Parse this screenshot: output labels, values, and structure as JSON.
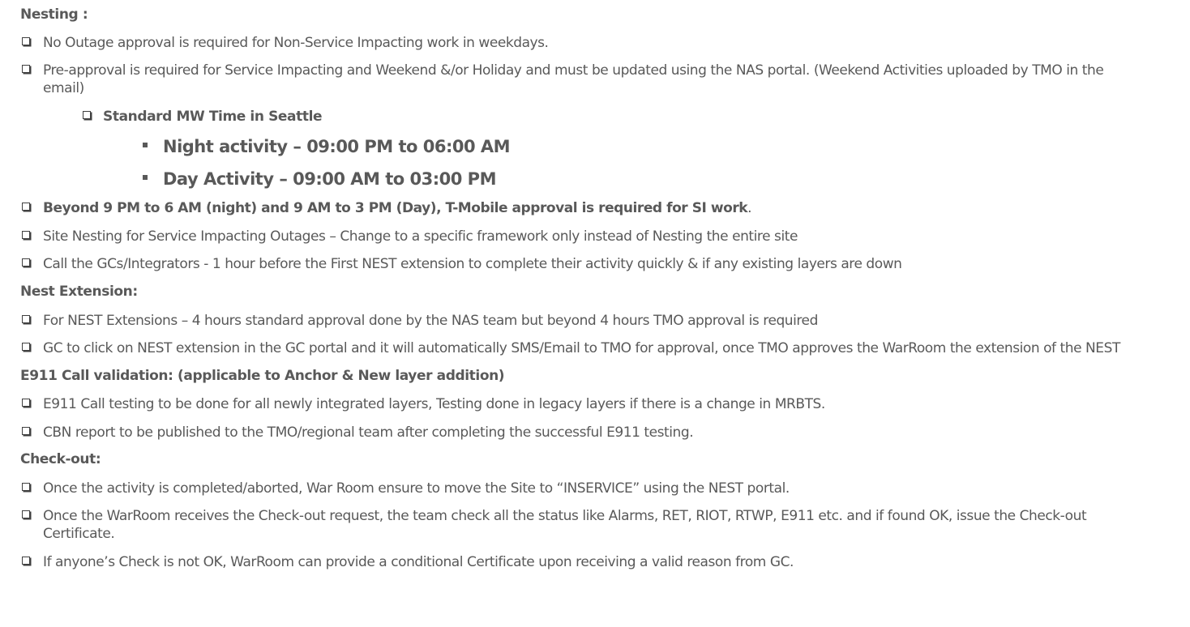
{
  "sections": {
    "nesting": {
      "title": "Nesting :",
      "items": [
        "No Outage approval is required for Non-Service Impacting work in weekdays.",
        "Pre-approval is required for Service Impacting and Weekend &/or Holiday and must be updated using the NAS portal. (Weekend Activities uploaded by TMO in the email)"
      ],
      "standard_mw": {
        "label": "Standard MW Time in Seattle",
        "night": "Night activity – 09:00 PM to 06:00 AM",
        "day": "Day Activity – 09:00 AM to 03:00 PM"
      },
      "items_after": {
        "beyond_bold": "Beyond 9 PM to 6 AM (night) and 9 AM to 3 PM (Day), T-Mobile approval is required for SI work",
        "beyond_tail": ".",
        "site_nesting": "Site Nesting for Service Impacting Outages – Change to a specific framework only instead of Nesting the entire site",
        "call_gcs": "Call the GCs/Integrators -  1 hour before the First NEST extension to complete their activity quickly & if any existing layers are down"
      }
    },
    "nest_extension": {
      "title": "Nest Extension:",
      "items": [
        "For NEST Extensions  – 4 hours standard approval done by the NAS team but beyond 4 hours TMO approval is required",
        "GC to click on NEST extension in the GC portal and it will automatically SMS/Email to TMO for approval, once TMO approves the WarRoom the extension of the NEST"
      ]
    },
    "e911": {
      "title": "E911 Call validation: (applicable to Anchor & New layer addition)",
      "items": [
        "E911 Call testing to be done for all newly integrated layers, Testing done in legacy layers if there is a change in MRBTS.",
        "CBN report to be published to the TMO/regional team after completing the successful E911 testing."
      ]
    },
    "checkout": {
      "title": "Check-out:",
      "items": [
        "Once the activity is completed/aborted, War Room ensure to move the Site to “INSERVICE” using the NEST portal.",
        "Once the WarRoom receives the Check-out request, the team check all the status like Alarms, RET, RIOT, RTWP, E911 etc. and if found OK, issue the Check-out Certificate.",
        "If anyone’s Check is not OK, WarRoom can provide a conditional Certificate upon receiving a valid reason from GC."
      ]
    }
  }
}
